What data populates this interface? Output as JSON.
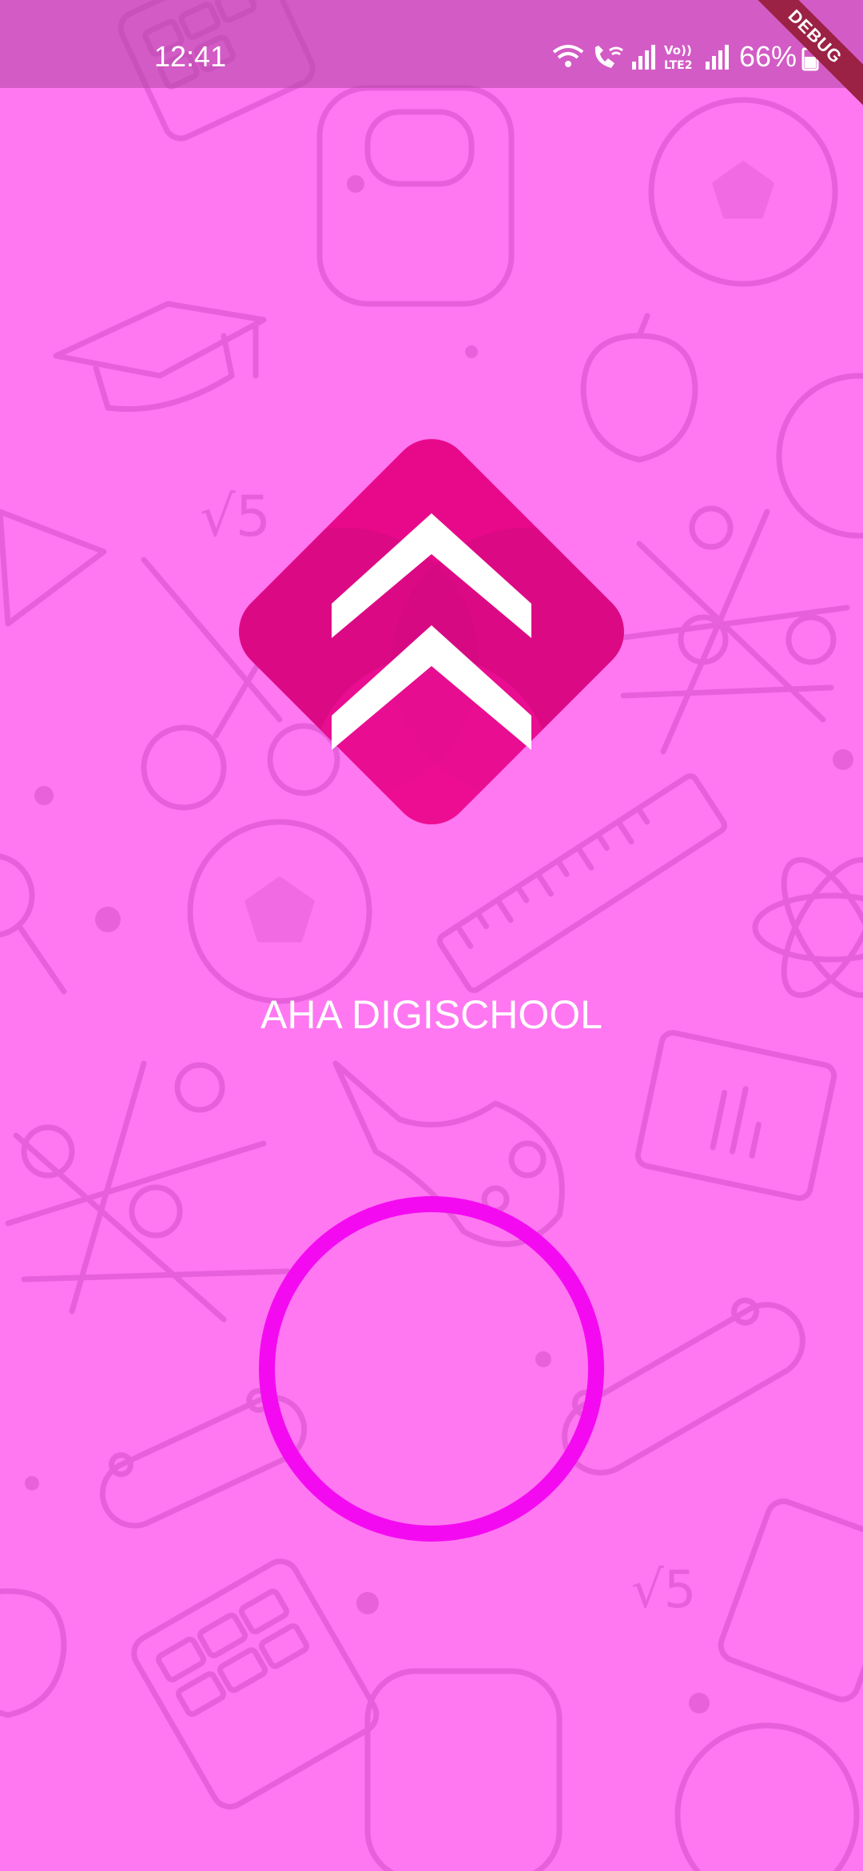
{
  "status_bar": {
    "time": "12:41",
    "battery": "66%",
    "icons": [
      "wifi-icon",
      "wifi-calling-icon",
      "signal-icon",
      "volte-lte2-icon",
      "signal-icon",
      "battery-icon"
    ]
  },
  "debug_banner": "DEBUG",
  "app": {
    "title": "AHA DIGISCHOOL",
    "logo": "chevron-up-logo-icon",
    "loader": "loading-spinner"
  },
  "colors": {
    "background": "#FF77F1",
    "logo": "#E8098B",
    "spinner": "#F40AF1",
    "debug": "#9B2145"
  }
}
